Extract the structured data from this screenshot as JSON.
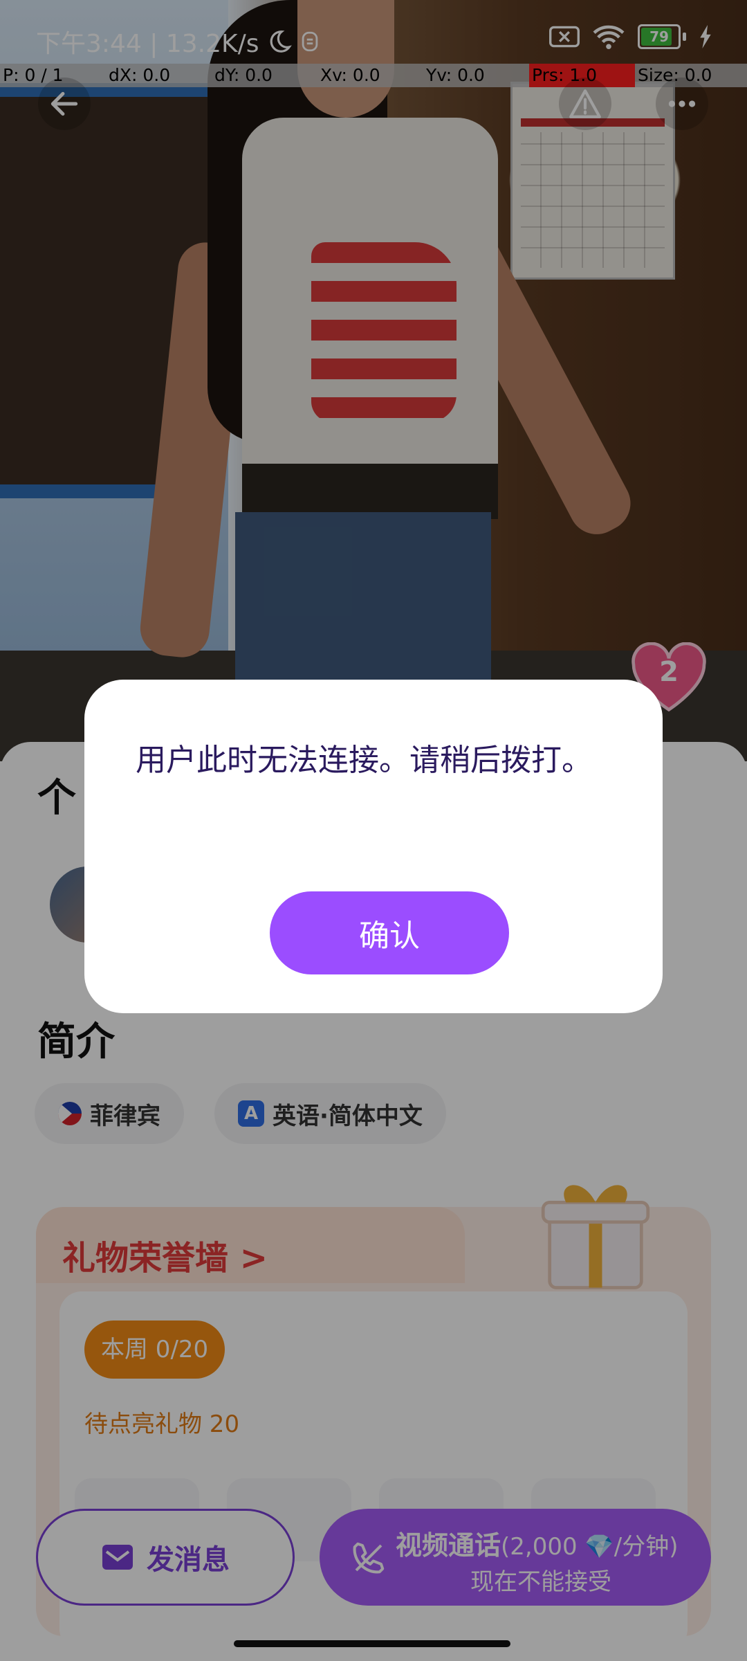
{
  "status_bar": {
    "time_speed": "下午3:44 | 13.2K/s",
    "battery_level": "79"
  },
  "debug_overlay": {
    "p": "P: 0 / 1",
    "dx": "dX: 0.0",
    "dy": "dY: 0.0",
    "xv": "Xv: 0.0",
    "yv": "Yv: 0.0",
    "prs": "Prs: 1.0",
    "size": "Size: 0.0"
  },
  "profile": {
    "like_count": "2",
    "section_personal": "个",
    "section_intro": "简介",
    "country": "菲律宾",
    "languages": "英语·简体中文"
  },
  "gifts": {
    "title": "礼物荣誉墙 >",
    "week_label": "本周 0/20",
    "pending_label": "待点亮礼物 20"
  },
  "actions": {
    "message_label": "发消息",
    "call_label": "视频通话",
    "call_price": "(2,000 💎/分钟)",
    "call_status": "现在不能接受"
  },
  "dialog": {
    "message": "用户此时无法连接。请稍后拨打。",
    "confirm_label": "确认"
  },
  "colors": {
    "accent_purple": "#9b4dff",
    "gift_orange": "#f28c15",
    "gift_title_red": "#e03a3a"
  }
}
